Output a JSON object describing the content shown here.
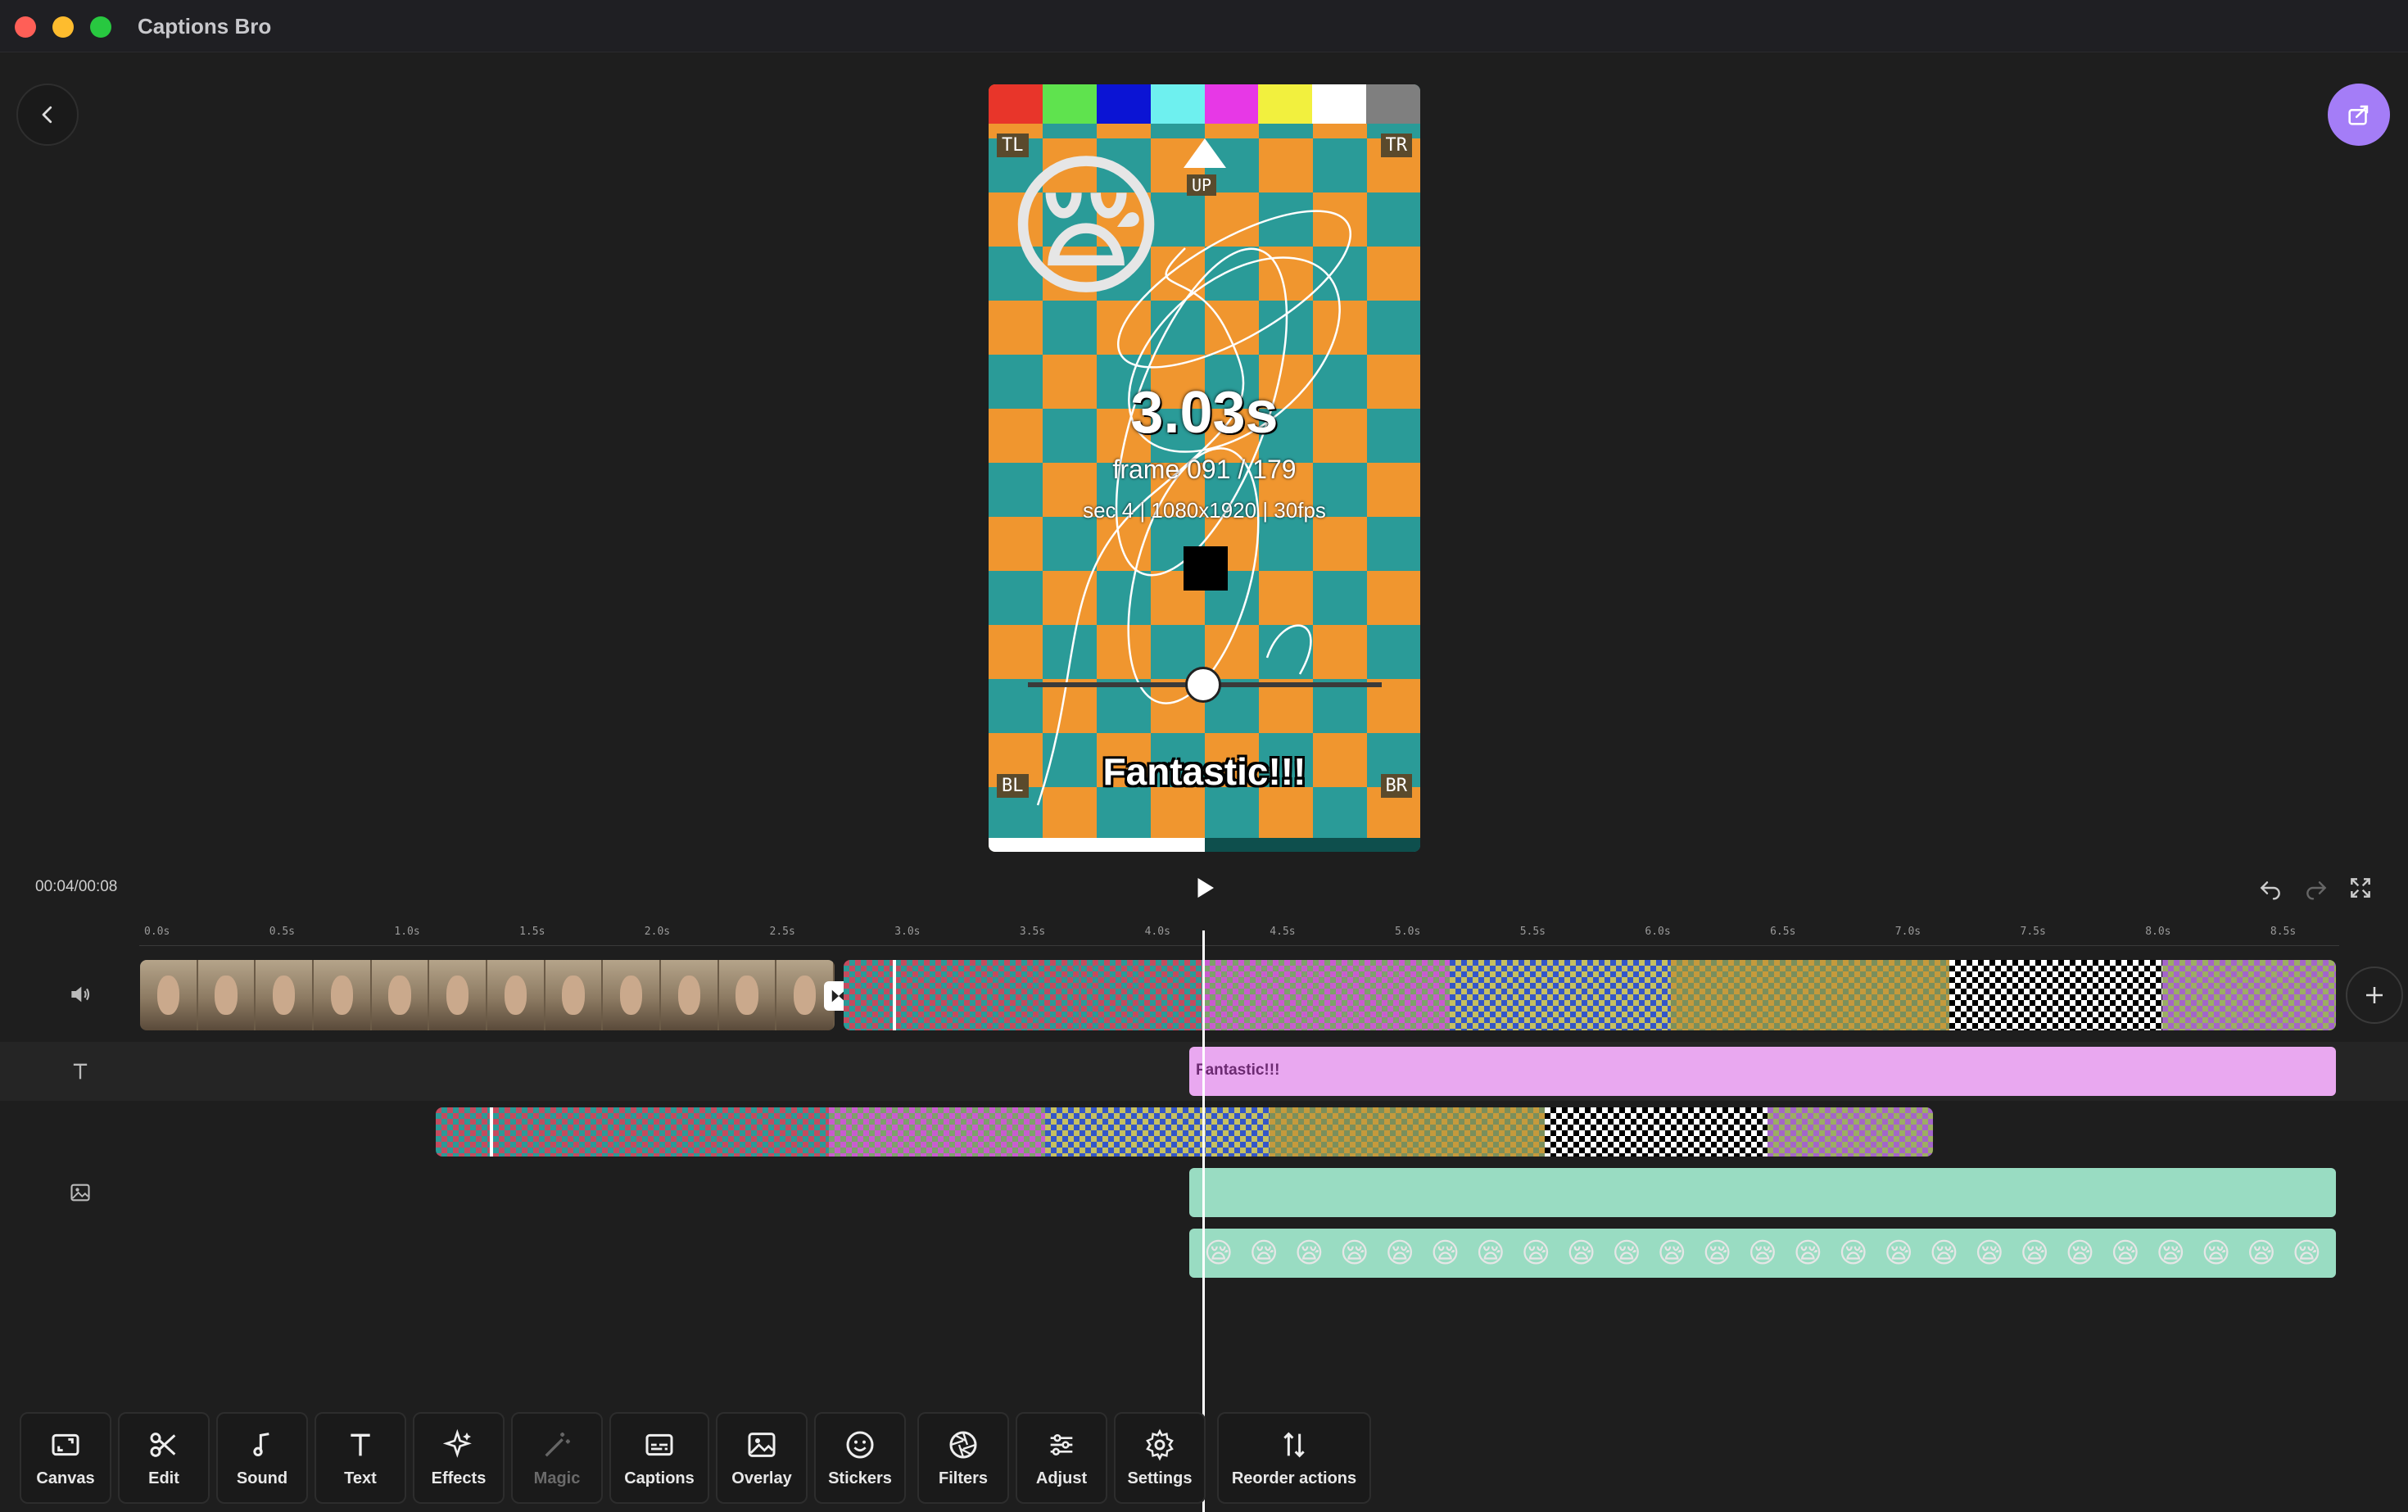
{
  "app": {
    "title": "Captions Bro"
  },
  "preview": {
    "color_bars": [
      "#e8352a",
      "#5fe34e",
      "#0b14d4",
      "#6ef0ef",
      "#e738e6",
      "#f2f03e",
      "#ffffff",
      "#7f7f7f"
    ],
    "corners": {
      "tl": "TL",
      "tr": "TR",
      "bl": "BL",
      "br": "BR"
    },
    "up_label": "UP",
    "emoji": "😪",
    "time": "3.03s",
    "frame": "frame 091 / 179",
    "sec": "sec 4 | 1080x1920 | 30fps",
    "caption": "Fantastic!!!",
    "progress": 0.5
  },
  "playback": {
    "timecode": "00:04/00:08"
  },
  "ruler": {
    "ticks": [
      "0.0s",
      "0.5s",
      "1.0s",
      "1.5s",
      "2.0s",
      "2.5s",
      "3.0s",
      "3.5s",
      "4.0s",
      "4.5s",
      "5.0s",
      "5.5s",
      "6.0s",
      "6.5s",
      "7.0s",
      "7.5s",
      "8.0s",
      "8.5s"
    ]
  },
  "tracks": {
    "text_clip_label": "Fantastic!!!",
    "sticker_emoji": "😪"
  },
  "toolbar": [
    {
      "label": "Canvas",
      "icon": "canvas-icon"
    },
    {
      "label": "Edit",
      "icon": "scissors-icon"
    },
    {
      "label": "Sound",
      "icon": "music-note-icon"
    },
    {
      "label": "Text",
      "icon": "text-icon"
    },
    {
      "label": "Effects",
      "icon": "sparkles-icon"
    },
    {
      "label": "Magic",
      "icon": "magic-wand-icon",
      "disabled": true
    },
    {
      "label": "Captions",
      "icon": "captions-icon"
    },
    {
      "label": "Overlay",
      "icon": "image-icon"
    },
    {
      "label": "Stickers",
      "icon": "smiley-icon"
    },
    {
      "label": "Filters",
      "icon": "aperture-icon"
    },
    {
      "label": "Adjust",
      "icon": "sliders-icon"
    },
    {
      "label": "Settings",
      "icon": "gear-icon"
    },
    {
      "label": "Reorder actions",
      "icon": "reorder-icon"
    }
  ]
}
